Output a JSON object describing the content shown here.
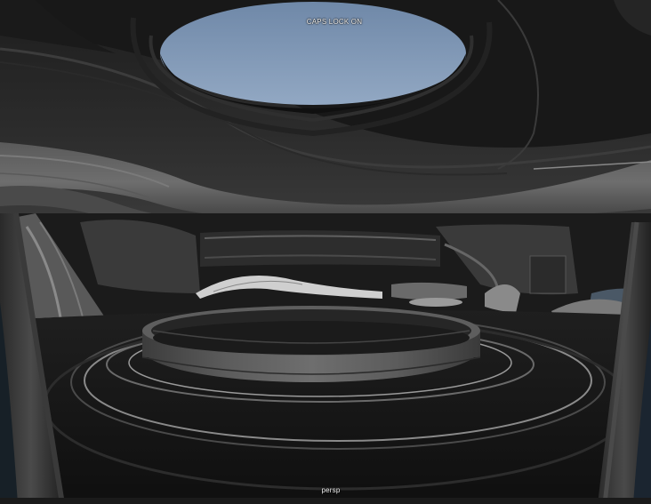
{
  "viewport": {
    "camera": "persp",
    "status_message": "CAPS LOCK ON"
  },
  "colors": {
    "sky": "#7f98b6",
    "background": "#141414",
    "hud_text": "#f2f2f2",
    "model_dark": "#1c1c1c",
    "model_mid": "#4a4a4a",
    "model_light": "#8c8c8c"
  }
}
